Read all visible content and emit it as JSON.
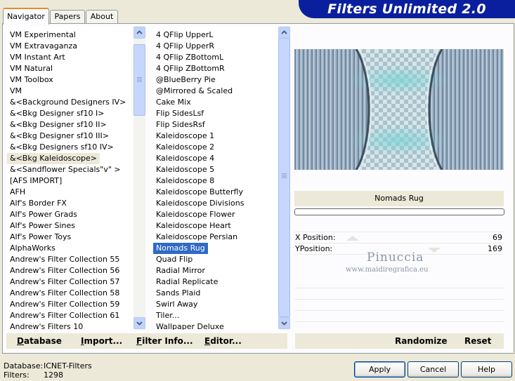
{
  "tabs": [
    "Navigator",
    "Papers",
    "About"
  ],
  "brand_title": "Filters Unlimited 2.0",
  "categories": [
    "VM Experimental",
    "VM Extravaganza",
    "VM Instant Art",
    "VM Natural",
    "VM Toolbox",
    "VM",
    "&<Background Designers IV>",
    "&<Bkg Designer sf10 I>",
    "&<Bkg Designer sf10 II>",
    "&<Bkg Designer sf10 III>",
    "&<Bkg Designers sf10 IV>",
    "&<Bkg Kaleidoscope>",
    "&<Sandflower Specials\"v\" >",
    "[AFS IMPORT]",
    "AFH",
    "Alf's Border FX",
    "Alf's Power Grads",
    "Alf's Power Sines",
    "Alf's Power Toys",
    "AlphaWorks",
    "Andrew's Filter Collection 55",
    "Andrew's Filter Collection 56",
    "Andrew's Filter Collection 57",
    "Andrew's Filter Collection 58",
    "Andrew's Filter Collection 59",
    "Andrew's Filter Collection 61",
    "Andrew's Filters 10"
  ],
  "selected_category": "&<Bkg Kaleidoscope>",
  "filters": [
    "4 QFlip UpperL",
    "4 QFlip UpperR",
    "4 QFlip ZBottomL",
    "4 QFlip ZBottomR",
    "@BlueBerry Pie",
    "@Mirrored & Scaled",
    "Cake Mix",
    "Flip SidesLsf",
    "Flip SidesRsf",
    "Kaleidoscope 1",
    "Kaleidoscope 2",
    "Kaleidoscope 4",
    "Kaleidoscope 5",
    "Kaleidoscope 8",
    "Kaleidoscope Butterfly",
    "Kaleidoscope Divisions",
    "Kaleidoscope Flower",
    "Kaleidoscope Heart",
    "Kaleidoscope Persian",
    "Nomads Rug",
    "Quad Flip",
    "Radial Mirror",
    "Radial Replicate",
    "Sands Plaid",
    "Swirl Away",
    "Tiler...",
    "Wallpaper Deluxe"
  ],
  "selected_filter": "Nomads Rug",
  "filter_name": "Nomads Rug",
  "params": [
    {
      "label": "X Position:",
      "value": "69"
    },
    {
      "label": "YPosition:",
      "value": "169"
    }
  ],
  "watermark": {
    "name": "Pinuccia",
    "url": "www.maidiregrafica.eu"
  },
  "bottom_buttons": {
    "database": "Database",
    "import": "Import...",
    "filter_info": "Filter Info...",
    "editor": "Editor...",
    "randomize": "Randomize",
    "reset": "Reset"
  },
  "status": {
    "database_label": "Database:",
    "database_value": "ICNET-Filters",
    "filters_label": "Filters:",
    "filters_value": "1298"
  },
  "dialog_buttons": {
    "apply": "Apply",
    "cancel": "Cancel",
    "help": "Help"
  },
  "colors": {
    "brand": "#0a1f9e",
    "selection": "#316ac5",
    "tab_accent": "#e68b2c"
  }
}
